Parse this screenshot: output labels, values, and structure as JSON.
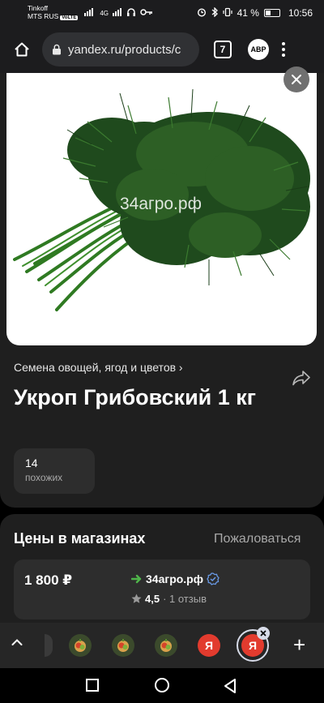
{
  "status_bar": {
    "carrier_line1": "Tinkoff",
    "carrier_line2": "MTS RUS",
    "volte": "VoLTE",
    "network": "4G",
    "battery": "41 %",
    "battery_level": 0.41,
    "time": "10:56"
  },
  "browser": {
    "url": "yandex.ru/products/c",
    "tab_count": "7",
    "adblock_label": "ABP"
  },
  "product": {
    "image_watermark": "34агро.рф",
    "category": "Семена овощей, ягод и цветов ›",
    "title": "Укроп Грибовский 1 кг",
    "similar_count": "14",
    "similar_label": "похожих"
  },
  "prices": {
    "heading": "Цены в магазинах",
    "report_link": "Пожаловаться",
    "offers": [
      {
        "price": "1 800 ₽",
        "shop": "34агро.рф",
        "rating": "4,5",
        "reviews": "· 1 отзыв"
      }
    ]
  },
  "tab_strip": {
    "tabs": [
      {
        "icon": "vegetables-favicon"
      },
      {
        "icon": "vegetables-favicon"
      },
      {
        "icon": "vegetables-favicon"
      },
      {
        "icon": "yandex-favicon",
        "letter": "Я"
      },
      {
        "icon": "yandex-favicon",
        "letter": "Я",
        "active": true
      }
    ],
    "add_label": "+"
  },
  "colors": {
    "surface": "#1f1f1f",
    "chip": "#2d2d2d",
    "verified": "#6a9be8",
    "go_arrow": "#4fb54a",
    "yandex_red": "#e23b2e"
  }
}
